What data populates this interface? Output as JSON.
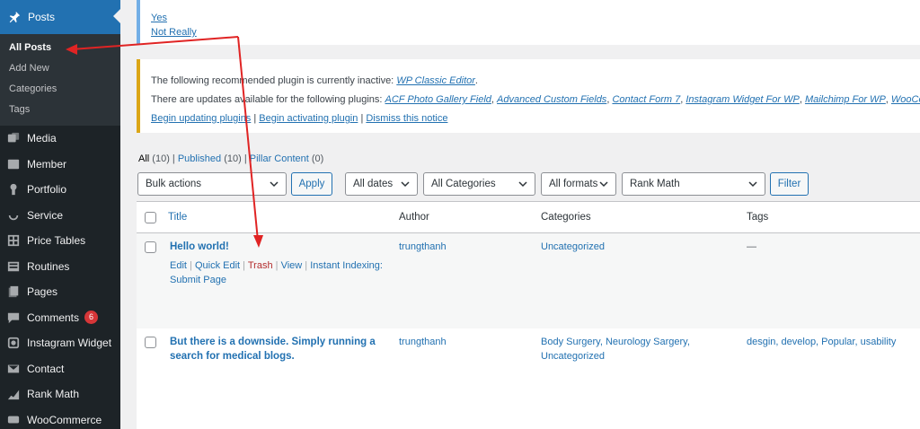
{
  "sidebar": {
    "posts_label": "Posts",
    "submenu": [
      "All Posts",
      "Add New",
      "Categories",
      "Tags"
    ],
    "items": [
      {
        "label": "Media",
        "icon": "media-icon"
      },
      {
        "label": "Member",
        "icon": "member-icon"
      },
      {
        "label": "Portfolio",
        "icon": "portfolio-icon"
      },
      {
        "label": "Service",
        "icon": "service-icon"
      },
      {
        "label": "Price Tables",
        "icon": "price-tables-icon"
      },
      {
        "label": "Routines",
        "icon": "routines-icon"
      },
      {
        "label": "Pages",
        "icon": "pages-icon"
      },
      {
        "label": "Comments",
        "icon": "comments-icon",
        "badge": "6"
      },
      {
        "label": "Instagram Widget",
        "icon": "instagram-icon"
      },
      {
        "label": "Contact",
        "icon": "contact-icon"
      },
      {
        "label": "Rank Math",
        "icon": "rank-math-icon"
      },
      {
        "label": "WooCommerce",
        "icon": "woocommerce-icon"
      }
    ]
  },
  "top_notice": {
    "yes": "Yes",
    "not_really": "Not Really"
  },
  "warning_notice": {
    "line1_prefix": "The following recommended plugin is currently inactive: ",
    "line1_link": "WP Classic Editor",
    "line1_suffix": ".",
    "line2_prefix": "There are updates available for the following plugins: ",
    "plugins": [
      "ACF Photo Gallery Field",
      "Advanced Custom Fields",
      "Contact Form 7",
      "Instagram Widget For WP",
      "Mailchimp For WP",
      "WooCom"
    ],
    "action_update": "Begin updating plugins",
    "action_activate": "Begin activating plugin",
    "action_dismiss": "Dismiss this notice",
    "sep": "|"
  },
  "filters_views": {
    "all": "All",
    "all_count": "(10)",
    "published": "Published",
    "published_count": "(10)",
    "pillar": "Pillar Content",
    "pillar_count": "(0)",
    "sep": "|"
  },
  "toolbar": {
    "bulk_actions": "Bulk actions",
    "apply": "Apply",
    "dates": "All dates",
    "categories": "All Categories",
    "formats": "All formats",
    "rank_math": "Rank Math",
    "filter": "Filter"
  },
  "table": {
    "headers": {
      "title": "Title",
      "author": "Author",
      "categories": "Categories",
      "tags": "Tags"
    },
    "rows": [
      {
        "title": "Hello world!",
        "author": "trungthanh",
        "categories": "Uncategorized",
        "tags": "—",
        "actions": {
          "edit": "Edit",
          "quick_edit": "Quick Edit",
          "trash": "Trash",
          "view": "View",
          "instant_indexing": "Instant Indexing:",
          "submit_page": "Submit Page"
        }
      },
      {
        "title_line1": "But there is a downside. Simply running a",
        "title_line2": "search for medical blogs.",
        "author": "trungthanh",
        "categories_line1": "Body Surgery, Neurology Sargery,",
        "categories_line2": "Uncategorized",
        "tags": "desgin, develop, Popular, usability"
      }
    ]
  },
  "colors": {
    "sidebar_bg": "#1d2327",
    "accent": "#2271b1",
    "arrow": "#e02424"
  }
}
